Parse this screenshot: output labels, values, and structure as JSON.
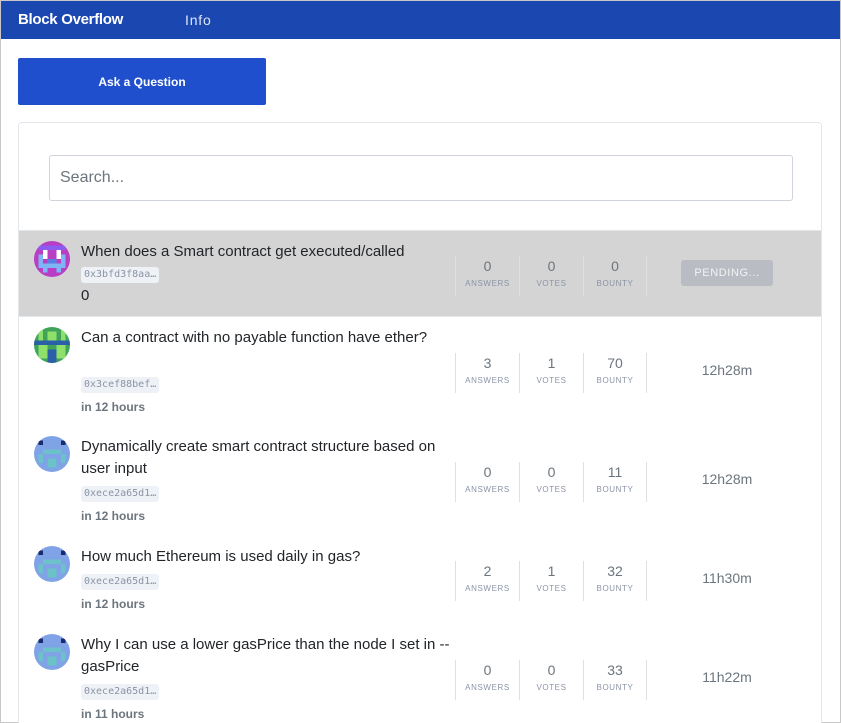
{
  "navbar": {
    "brand": "Block Overflow",
    "info_link": "Info",
    "color": "#1a47b0"
  },
  "ask_button": {
    "label": "Ask a Question",
    "color": "#1f4fcc"
  },
  "search": {
    "placeholder": "Search...",
    "value": ""
  },
  "stat_labels": {
    "answers": "ANSWERS",
    "votes": "VOTES",
    "bounty": "BOUNTY"
  },
  "questions": [
    {
      "title": "When does a Smart contract get executed/called",
      "address": "0x3bfd3f8aa…",
      "sub": "0",
      "answers": "0",
      "votes": "0",
      "bounty": "0",
      "status": "PENDING...",
      "avatar_icon": "identicon-magenta"
    },
    {
      "title": "Can a contract with no payable function have ether?",
      "address": "0x3cef88bef…",
      "sub": "in 12 hours",
      "answers": "3",
      "votes": "1",
      "bounty": "70",
      "time": "12h28m",
      "avatar_icon": "identicon-green"
    },
    {
      "title": "Dynamically create smart contract structure based on user input",
      "address": "0xece2a65d1…",
      "sub": "in 12 hours",
      "answers": "0",
      "votes": "0",
      "bounty": "11",
      "time": "12h28m",
      "avatar_icon": "identicon-blue"
    },
    {
      "title": "How much Ethereum is used daily in gas?",
      "address": "0xece2a65d1…",
      "sub": "in 12 hours",
      "answers": "2",
      "votes": "1",
      "bounty": "32",
      "time": "11h30m",
      "avatar_icon": "identicon-blue"
    },
    {
      "title": "Why I can use a lower gasPrice than the node I set in --gasPrice",
      "address": "0xece2a65d1…",
      "sub": "in 11 hours",
      "answers": "0",
      "votes": "0",
      "bounty": "33",
      "time": "11h22m",
      "avatar_icon": "identicon-blue"
    }
  ]
}
